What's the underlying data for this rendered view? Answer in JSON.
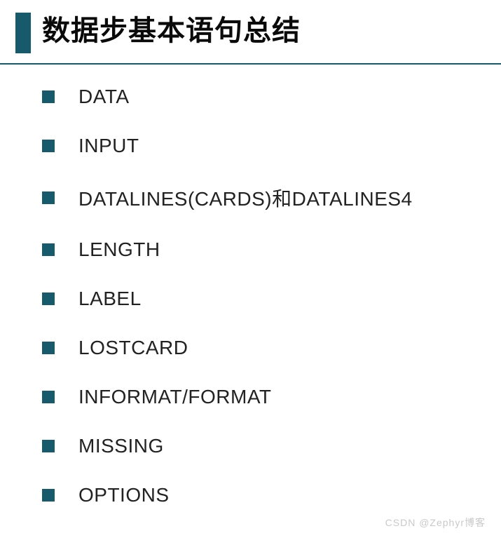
{
  "title": "数据步基本语句总结",
  "items": [
    "DATA",
    "INPUT",
    "DATALINES(CARDS)和DATALINES4",
    "LENGTH",
    "LABEL",
    "LOSTCARD",
    "INFORMAT/FORMAT",
    "MISSING",
    "OPTIONS"
  ],
  "watermark": "CSDN @Zephyr博客"
}
